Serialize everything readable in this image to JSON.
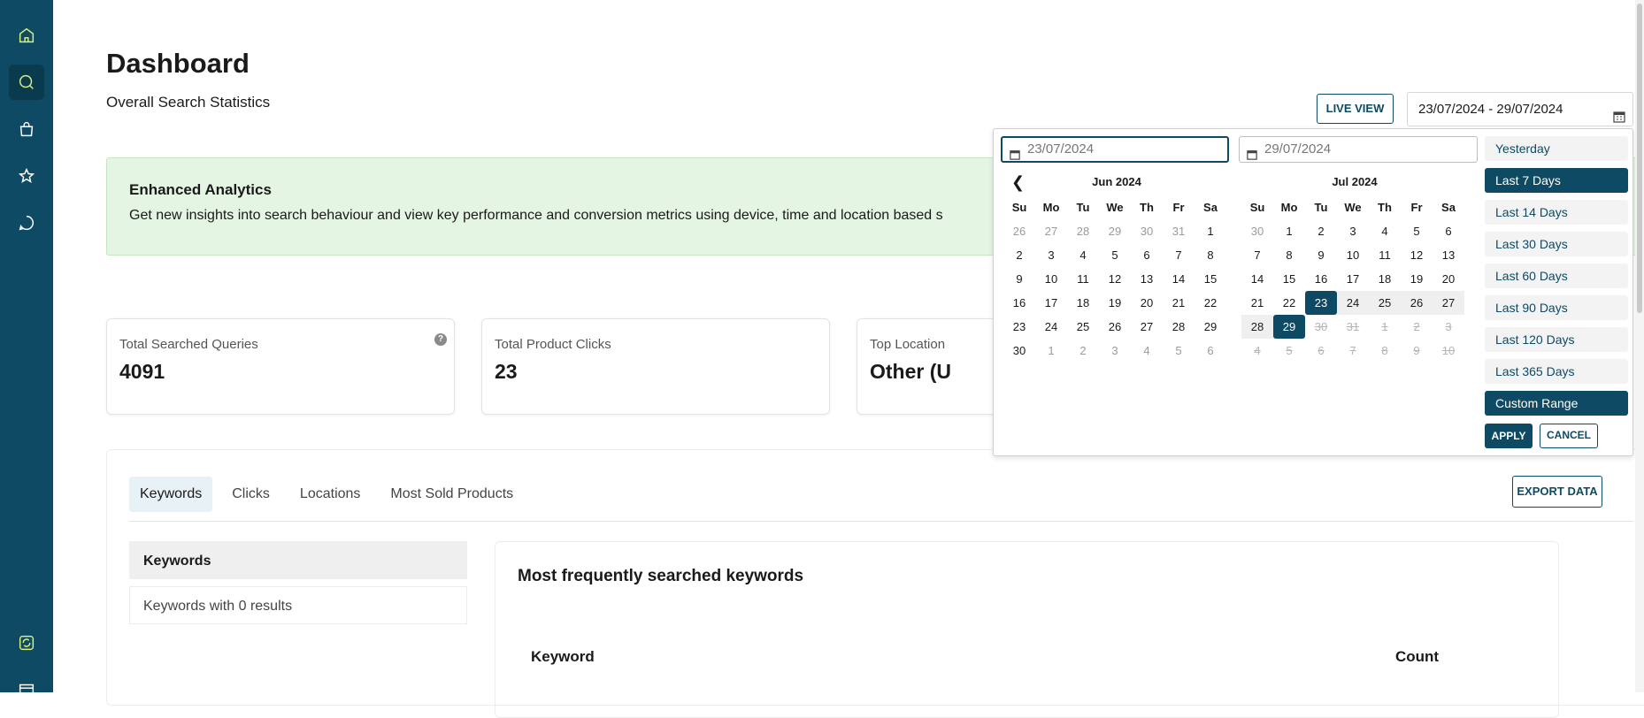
{
  "sidebar": {
    "icons": [
      "home-icon",
      "search-analytics-icon",
      "shopping-bag-icon",
      "star-icon",
      "chat-icon",
      "sync-icon",
      "store-icon"
    ]
  },
  "header": {
    "title": "Dashboard",
    "subtitle": "Overall Search Statistics",
    "live_view": "LIVE VIEW",
    "date_range": "23/07/2024 - 29/07/2024"
  },
  "banner": {
    "title": "Enhanced Analytics",
    "text": "Get new insights into search behaviour and view key performance and conversion metrics using device, time and location based se"
  },
  "cards": [
    {
      "label": "Total Searched Queries",
      "value": "4091"
    },
    {
      "label": "Total Product Clicks",
      "value": "23"
    },
    {
      "label": "Top Location",
      "value": "Other (U"
    }
  ],
  "tabs": [
    "Keywords",
    "Clicks",
    "Locations",
    "Most Sold Products"
  ],
  "export_label": "EXPORT DATA",
  "side_list": [
    "Keywords",
    "Keywords with 0 results"
  ],
  "keywords_panel": {
    "title": "Most frequently searched keywords",
    "col_keyword": "Keyword",
    "col_count": "Count"
  },
  "picker": {
    "start_input": "23/07/2024",
    "end_input": "29/07/2024",
    "weekdays": [
      "Su",
      "Mo",
      "Tu",
      "We",
      "Th",
      "Fr",
      "Sa"
    ],
    "months": [
      {
        "title": "Jun 2024",
        "weeks": [
          [
            [
              "26",
              "muted"
            ],
            [
              "27",
              "muted"
            ],
            [
              "28",
              "muted"
            ],
            [
              "29",
              "muted"
            ],
            [
              "30",
              "muted"
            ],
            [
              "31",
              "muted"
            ],
            [
              "1",
              ""
            ]
          ],
          [
            [
              "2",
              ""
            ],
            [
              "3",
              ""
            ],
            [
              "4",
              ""
            ],
            [
              "5",
              ""
            ],
            [
              "6",
              ""
            ],
            [
              "7",
              ""
            ],
            [
              "8",
              ""
            ]
          ],
          [
            [
              "9",
              ""
            ],
            [
              "10",
              ""
            ],
            [
              "11",
              ""
            ],
            [
              "12",
              ""
            ],
            [
              "13",
              ""
            ],
            [
              "14",
              ""
            ],
            [
              "15",
              ""
            ]
          ],
          [
            [
              "16",
              ""
            ],
            [
              "17",
              ""
            ],
            [
              "18",
              ""
            ],
            [
              "19",
              ""
            ],
            [
              "20",
              ""
            ],
            [
              "21",
              ""
            ],
            [
              "22",
              ""
            ]
          ],
          [
            [
              "23",
              ""
            ],
            [
              "24",
              ""
            ],
            [
              "25",
              ""
            ],
            [
              "26",
              ""
            ],
            [
              "27",
              ""
            ],
            [
              "28",
              ""
            ],
            [
              "29",
              ""
            ]
          ],
          [
            [
              "30",
              ""
            ],
            [
              "1",
              "muted"
            ],
            [
              "2",
              "muted"
            ],
            [
              "3",
              "muted"
            ],
            [
              "4",
              "muted"
            ],
            [
              "5",
              "muted"
            ],
            [
              "6",
              "muted"
            ]
          ]
        ]
      },
      {
        "title": "Jul 2024",
        "weeks": [
          [
            [
              "30",
              "muted"
            ],
            [
              "1",
              ""
            ],
            [
              "2",
              ""
            ],
            [
              "3",
              ""
            ],
            [
              "4",
              ""
            ],
            [
              "5",
              ""
            ],
            [
              "6",
              ""
            ]
          ],
          [
            [
              "7",
              ""
            ],
            [
              "8",
              ""
            ],
            [
              "9",
              ""
            ],
            [
              "10",
              ""
            ],
            [
              "11",
              ""
            ],
            [
              "12",
              ""
            ],
            [
              "13",
              ""
            ]
          ],
          [
            [
              "14",
              ""
            ],
            [
              "15",
              ""
            ],
            [
              "16",
              ""
            ],
            [
              "17",
              ""
            ],
            [
              "18",
              ""
            ],
            [
              "19",
              ""
            ],
            [
              "20",
              ""
            ]
          ],
          [
            [
              "21",
              ""
            ],
            [
              "22",
              ""
            ],
            [
              "23",
              "sel"
            ],
            [
              "24",
              "range"
            ],
            [
              "25",
              "range"
            ],
            [
              "26",
              "range"
            ],
            [
              "27",
              "range"
            ]
          ],
          [
            [
              "28",
              "range"
            ],
            [
              "29",
              "sel"
            ],
            [
              "30",
              "disabled"
            ],
            [
              "31",
              "disabled"
            ],
            [
              "1",
              "disabled"
            ],
            [
              "2",
              "disabled"
            ],
            [
              "3",
              "disabled"
            ]
          ],
          [
            [
              "4",
              "disabled"
            ],
            [
              "5",
              "disabled"
            ],
            [
              "6",
              "disabled"
            ],
            [
              "7",
              "disabled"
            ],
            [
              "8",
              "disabled"
            ],
            [
              "9",
              "disabled"
            ],
            [
              "10",
              "disabled"
            ]
          ]
        ]
      }
    ],
    "ranges": [
      {
        "label": "Yesterday",
        "active": false
      },
      {
        "label": "Last 7 Days",
        "active": true
      },
      {
        "label": "Last 14 Days",
        "active": false
      },
      {
        "label": "Last 30 Days",
        "active": false
      },
      {
        "label": "Last 60 Days",
        "active": false
      },
      {
        "label": "Last 90 Days",
        "active": false
      },
      {
        "label": "Last 120 Days",
        "active": false
      },
      {
        "label": "Last 365 Days",
        "active": false
      },
      {
        "label": "Custom Range",
        "active": true
      }
    ],
    "apply": "APPLY",
    "cancel": "CANCEL"
  },
  "colors": {
    "primary": "#0e4a63",
    "banner_bg": "#e5f5e4",
    "sidebar_icon": "#d7f07a"
  }
}
